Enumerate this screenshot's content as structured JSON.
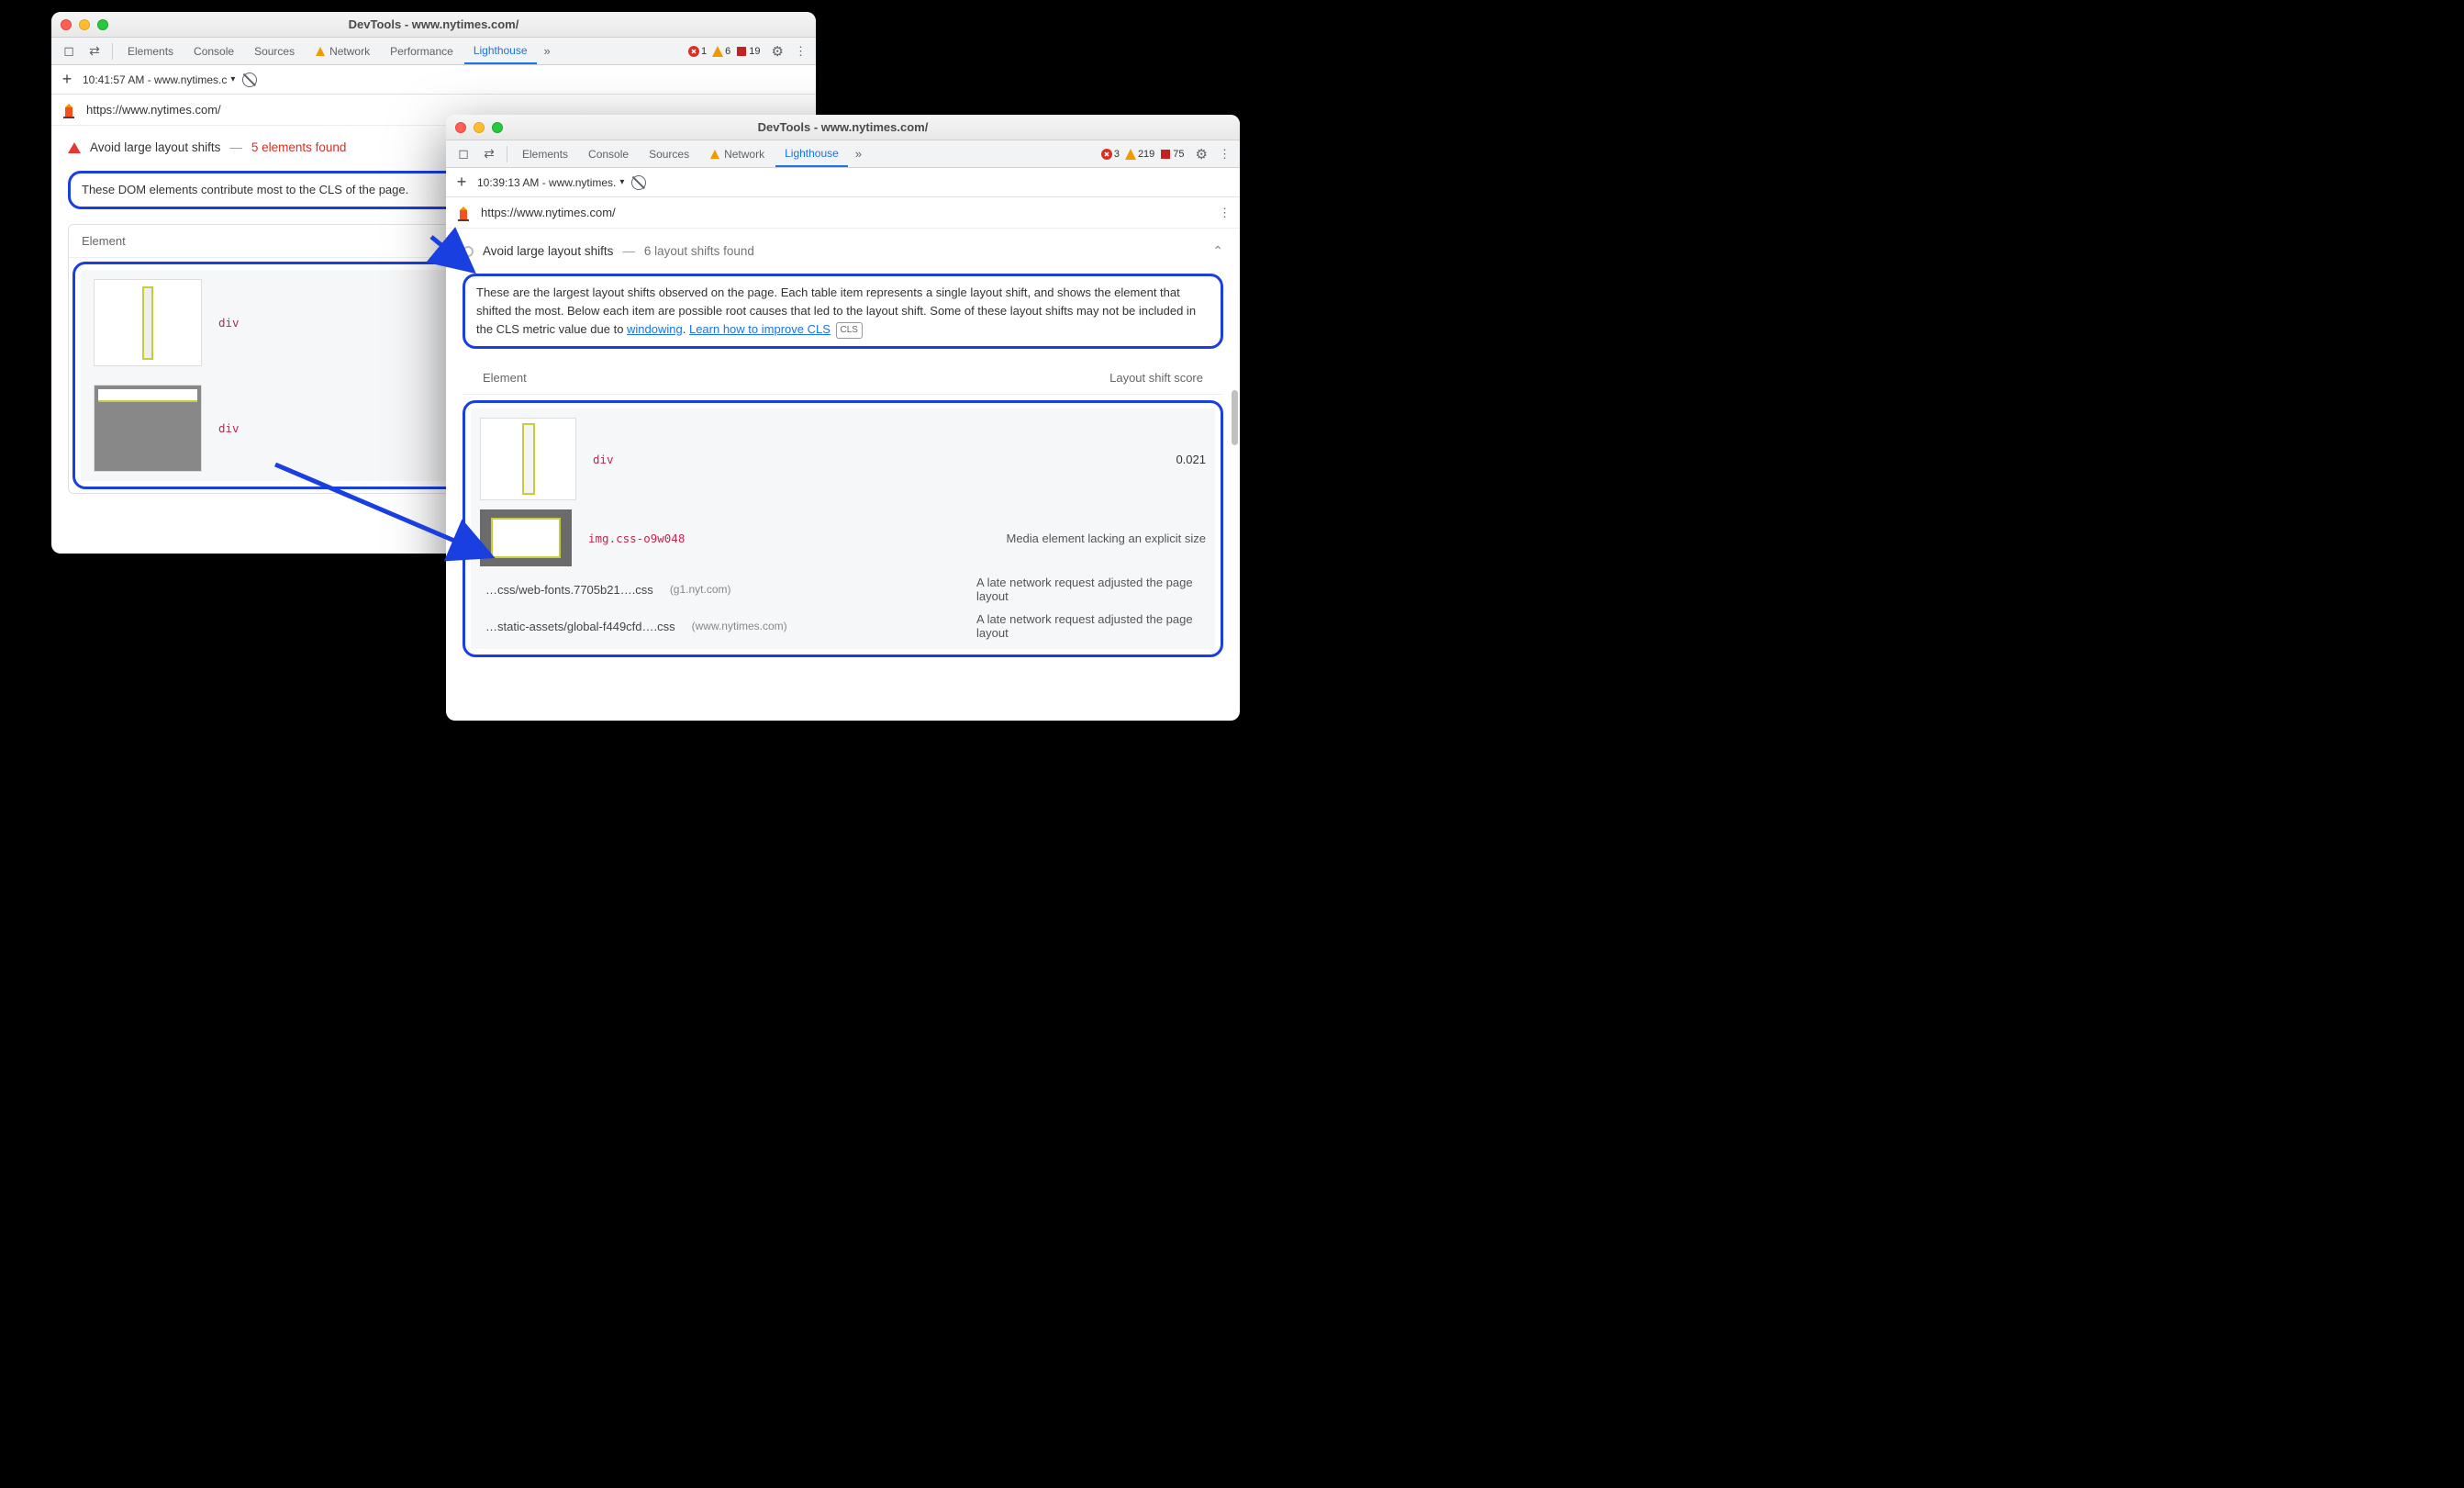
{
  "w1": {
    "title": "DevTools - www.nytimes.com/",
    "tabs": [
      "Elements",
      "Console",
      "Sources",
      "Network",
      "Performance",
      "Lighthouse"
    ],
    "activeTab": "Lighthouse",
    "badges": {
      "errors": 1,
      "warnings": 6,
      "violations": 19
    },
    "toolbar_time": "10:41:57 AM - www.nytimes.c",
    "url": "https://www.nytimes.com/",
    "audit_title": "Avoid large layout shifts",
    "audit_count": "5 elements found",
    "desc": "These DOM elements contribute most to the CLS of the page.",
    "col_element": "Element",
    "rows": [
      {
        "tag": "div"
      },
      {
        "tag": "div"
      }
    ]
  },
  "w2": {
    "title": "DevTools - www.nytimes.com/",
    "tabs": [
      "Elements",
      "Console",
      "Sources",
      "Network",
      "Lighthouse"
    ],
    "activeTab": "Lighthouse",
    "badges": {
      "errors": 3,
      "warnings": 219,
      "violations": 75
    },
    "toolbar_time": "10:39:13 AM - www.nytimes.",
    "url": "https://www.nytimes.com/",
    "audit_title": "Avoid large layout shifts",
    "audit_count": "6 layout shifts found",
    "desc_a": "These are the largest layout shifts observed on the page. Each table item represents a single layout shift, and shows the element that shifted the most. Below each item are possible root causes that led to the layout shift. Some of these layout shifts may not be included in the CLS metric value due to ",
    "desc_link1": "windowing",
    "desc_mid": ". ",
    "desc_link2": "Learn how to improve CLS",
    "cls_badge": "CLS",
    "col_element": "Element",
    "col_score": "Layout shift score",
    "row1_tag": "div",
    "row1_score": "0.021",
    "row2_tag": "img.css-o9w048",
    "row2_cause": "Media element lacking an explicit size",
    "row3_file": "…css/web-fonts.7705b21….css",
    "row3_host": "(g1.nyt.com)",
    "row3_cause": "A late network request adjusted the page layout",
    "row4_file": "…static-assets/global-f449cfd….css",
    "row4_host": "(www.nytimes.com)",
    "row4_cause": "A late network request adjusted the page layout"
  }
}
